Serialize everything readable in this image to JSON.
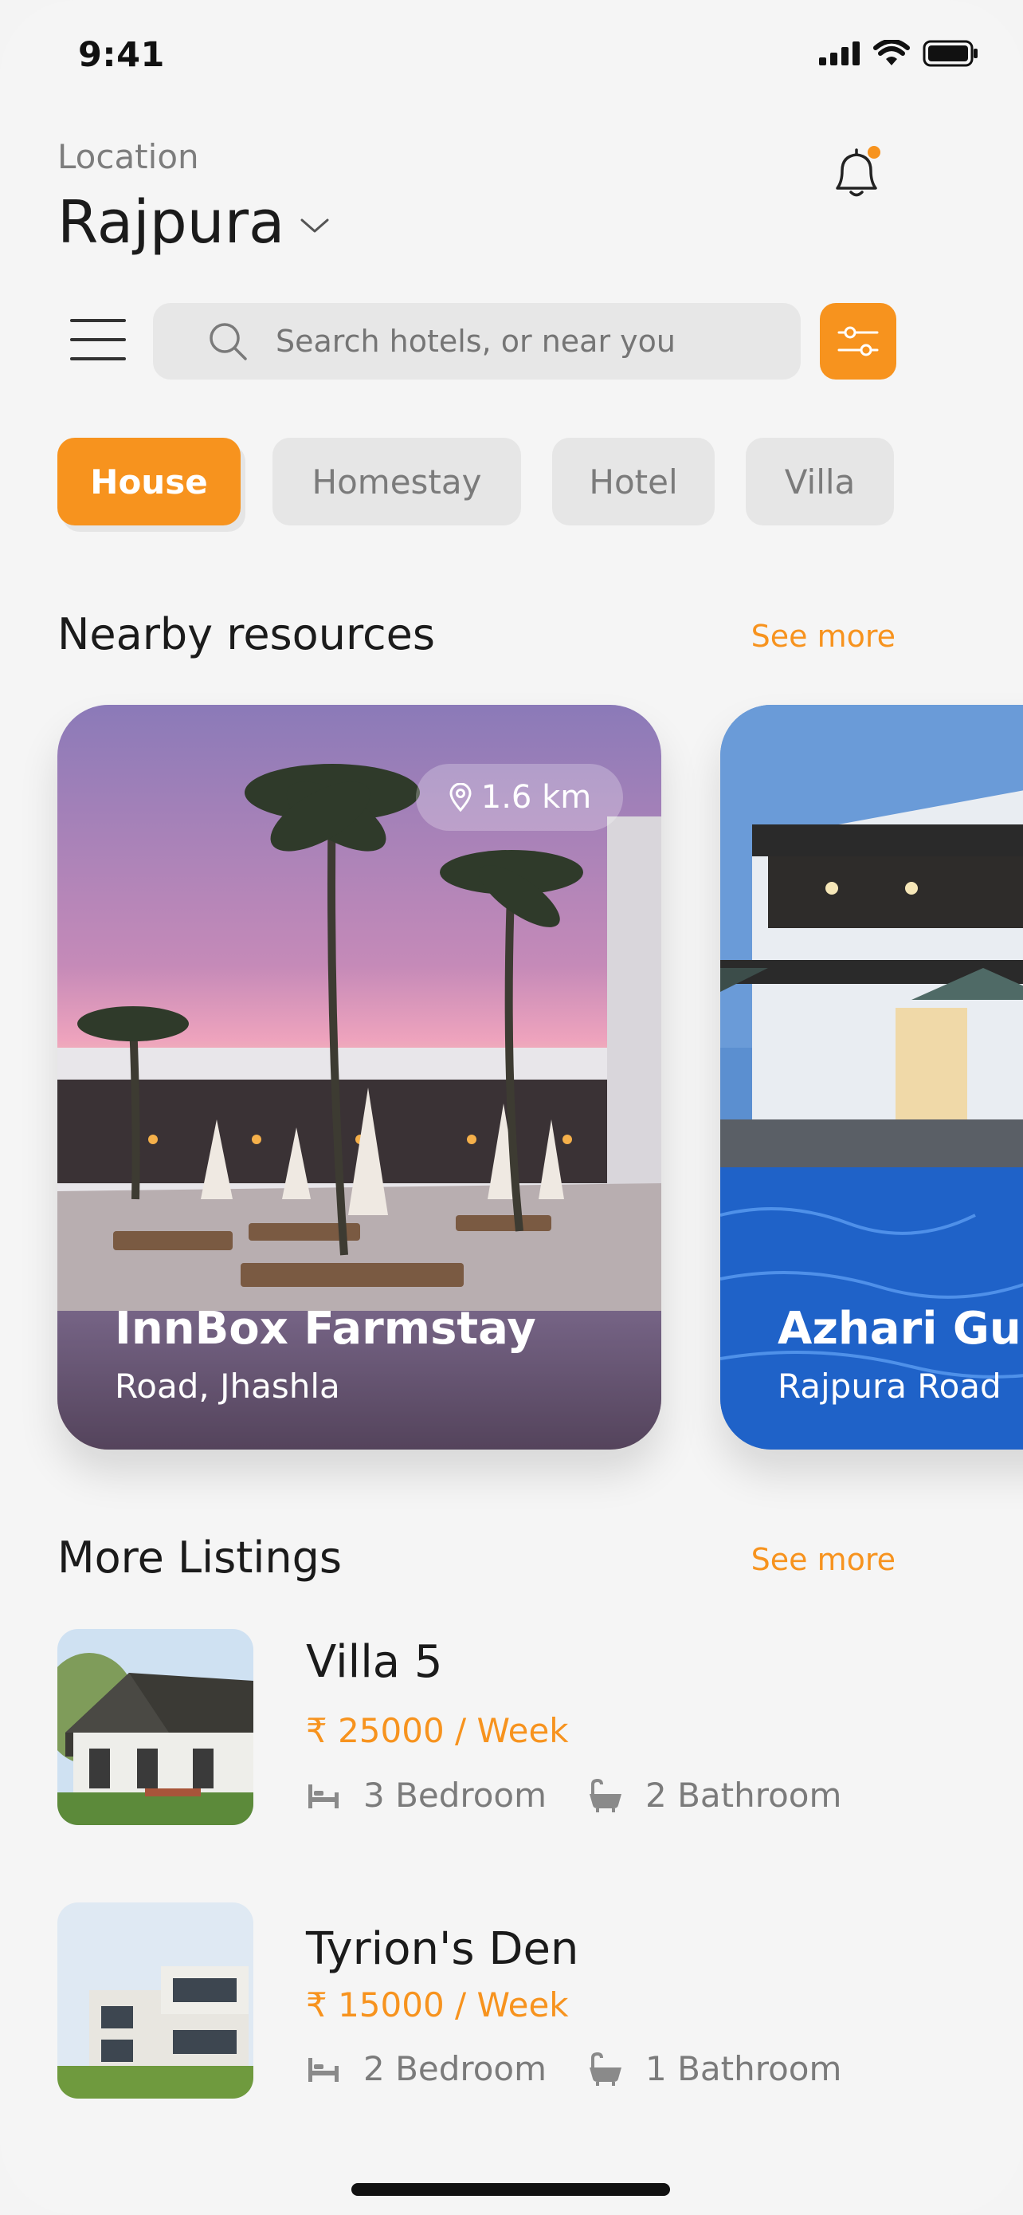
{
  "status_bar": {
    "time": "9:41"
  },
  "header": {
    "location_label": "Location",
    "location_name": "Rajpura"
  },
  "search": {
    "placeholder": "Search hotels, or near you"
  },
  "categories": [
    {
      "label": "House",
      "active": true
    },
    {
      "label": "Homestay",
      "active": false
    },
    {
      "label": "Hotel",
      "active": false
    },
    {
      "label": "Villa",
      "active": false
    }
  ],
  "nearby": {
    "title": "Nearby resources",
    "see_more": "See more",
    "cards": [
      {
        "distance": "1.6 km",
        "title": "InnBox Farmstay",
        "subtitle": "Road, Jhashla"
      },
      {
        "title": "Azhari Guest",
        "subtitle": "Rajpura Road"
      }
    ]
  },
  "listings": {
    "title": "More Listings",
    "see_more": "See more",
    "items": [
      {
        "title": "Villa 5",
        "price": "₹ 25000 / Week",
        "bedrooms": "3 Bedroom",
        "bathrooms": "2 Bathroom"
      },
      {
        "title": "Tyrion's Den",
        "price": "₹ 15000 / Week",
        "bedrooms": "2 Bedroom",
        "bathrooms": "1 Bathroom"
      }
    ]
  },
  "colors": {
    "accent": "#f7931e",
    "background": "#f5f5f5",
    "chip_inactive": "#e6e6e6"
  }
}
